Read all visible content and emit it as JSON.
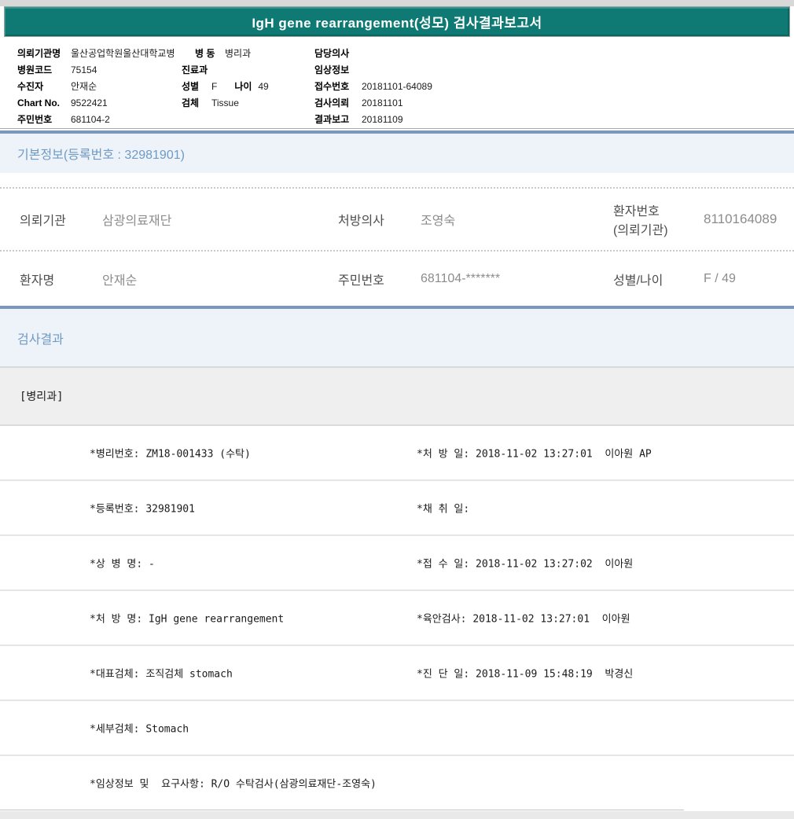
{
  "colors": {
    "accent_teal": "#0e7a73",
    "section_border_blue": "#7b97be",
    "section_bg_blue": "#edf3f9",
    "section_text_blue": "#6f9ac4",
    "label_gray": "#4e4e4e",
    "value_gray": "#8c8c8c"
  },
  "title_bar": {
    "title": "IgH gene rearrangement(성모) 검사결과보고서"
  },
  "patient_header": {
    "col1": [
      {
        "label": "의뢰기관명",
        "value": "울산공업학원울산대학교병"
      },
      {
        "label": "병원코드",
        "value": "75154"
      },
      {
        "label": "수진자",
        "value": "안재순"
      },
      {
        "label": "Chart No.",
        "value": "9522421"
      },
      {
        "label": "주민번호",
        "value": "681104-2"
      }
    ],
    "col2": [
      {
        "label": "병 동",
        "value": "병리과"
      },
      {
        "label": "진료과",
        "value": ""
      },
      {
        "label": "성별",
        "value": "F",
        "label2": "나이",
        "value2": "49"
      },
      {
        "label": "검체",
        "value": "Tissue"
      }
    ],
    "col3": [
      {
        "label": "담당의사",
        "value": ""
      },
      {
        "label": "임상정보",
        "value": ""
      },
      {
        "label": "접수번호",
        "value": "20181101-64089"
      },
      {
        "label": "검사의뢰",
        "value": "20181101"
      },
      {
        "label": "결과보고",
        "value": "20181109"
      }
    ]
  },
  "basic_info": {
    "title": "기본정보(등록번호 : 32981901)",
    "row1": {
      "c1_label": "의뢰기관",
      "c1_value": "삼광의료재단",
      "c2_label": "처방의사",
      "c2_value": "조영숙",
      "c3_label_line1": "환자번호",
      "c3_label_line2": "(의뢰기관)",
      "c3_value": "8110164089"
    },
    "row2": {
      "c1_label": "환자명",
      "c1_value": "안재순",
      "c2_label": "주민번호",
      "c2_value": "681104-*******",
      "c3_label": "성별/나이",
      "c3_value": "F / 49"
    }
  },
  "results": {
    "title": "검사결과",
    "department": "[병리과]",
    "rows": [
      {
        "left": "*병리번호: ZM18-001433 (수탁)",
        "right": "*처 방 일: 2018-11-02 13:27:01  이아원 AP"
      },
      {
        "left": "*등록번호: 32981901",
        "right": "*채 취 일:"
      },
      {
        "left": "*상 병 명: -",
        "right": "*접 수 일: 2018-11-02 13:27:02  이아원"
      },
      {
        "left": "*처 방 명: IgH gene rearrangement",
        "right": "*육안검사: 2018-11-02 13:27:01  이아원"
      },
      {
        "left": "*대표검체: 조직검체 stomach",
        "right": "*진 단 일: 2018-11-09 15:48:19  박경신"
      },
      {
        "left": "*세부검체: Stomach",
        "right": ""
      },
      {
        "left": "*임상정보 및  요구사항: R/O 수탁검사(삼광의료재단-조영숙)",
        "right": ""
      }
    ]
  }
}
